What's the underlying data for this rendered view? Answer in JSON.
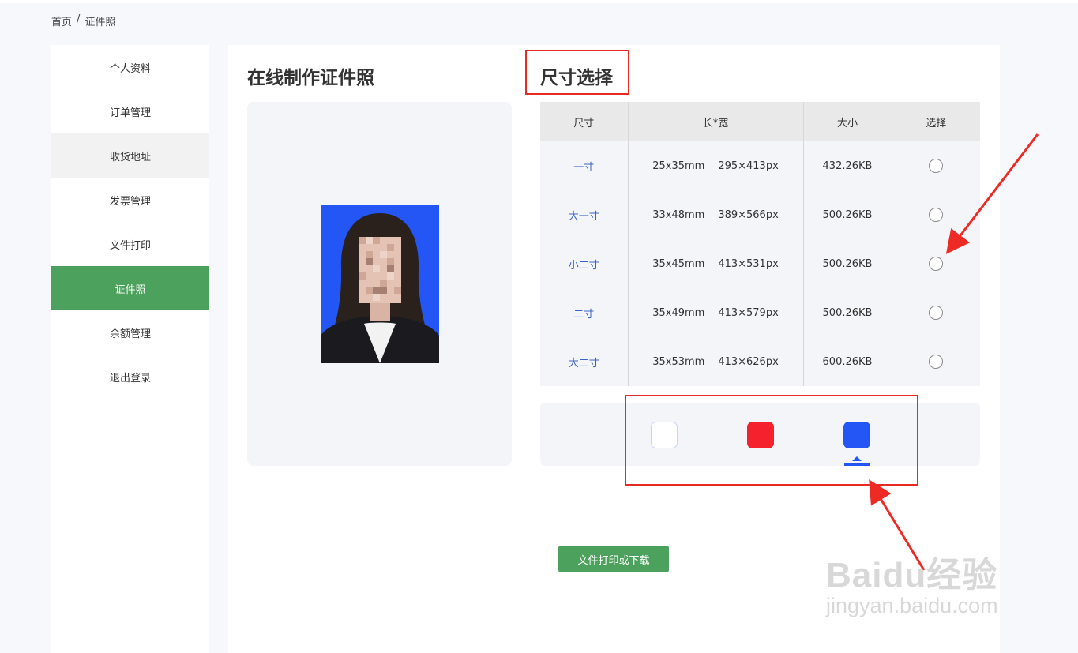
{
  "breadcrumb": {
    "home": "首页",
    "separator": "/",
    "current": "证件照"
  },
  "sidebar": {
    "items": [
      {
        "label": "个人资料"
      },
      {
        "label": "订单管理"
      },
      {
        "label": "收货地址"
      },
      {
        "label": "发票管理"
      },
      {
        "label": "文件打印"
      },
      {
        "label": "证件照"
      },
      {
        "label": "余额管理"
      },
      {
        "label": "退出登录"
      }
    ],
    "active": "证件照",
    "hovered": "收货地址"
  },
  "main": {
    "title": "在线制作证件照",
    "size_section_title": "尺寸选择",
    "table": {
      "headers": [
        "尺寸",
        "长*宽",
        "大小",
        "选择"
      ],
      "rows": [
        {
          "name": "一寸",
          "mm": "25x35mm",
          "px": "295×413px",
          "size": "432.26KB"
        },
        {
          "name": "大一寸",
          "mm": "33x48mm",
          "px": "389×566px",
          "size": "500.26KB"
        },
        {
          "name": "小二寸",
          "mm": "35x45mm",
          "px": "413×531px",
          "size": "500.26KB"
        },
        {
          "name": "二寸",
          "mm": "35x49mm",
          "px": "413×579px",
          "size": "500.26KB"
        },
        {
          "name": "大二寸",
          "mm": "35x53mm",
          "px": "413×626px",
          "size": "600.26KB"
        }
      ]
    },
    "background_colors": [
      {
        "name": "white",
        "hex": "#ffffff"
      },
      {
        "name": "red",
        "hex": "#f5222d"
      },
      {
        "name": "blue",
        "hex": "#2356f5"
      }
    ],
    "selected_background": "blue",
    "download_button": "文件打印或下载"
  },
  "colors": {
    "accent_green": "#4ca15d",
    "highlight_red": "#e52b22",
    "link_blue": "#3b63c7"
  },
  "watermark": {
    "main": "Baidu经验",
    "sub": "jingyan.baidu.com"
  }
}
